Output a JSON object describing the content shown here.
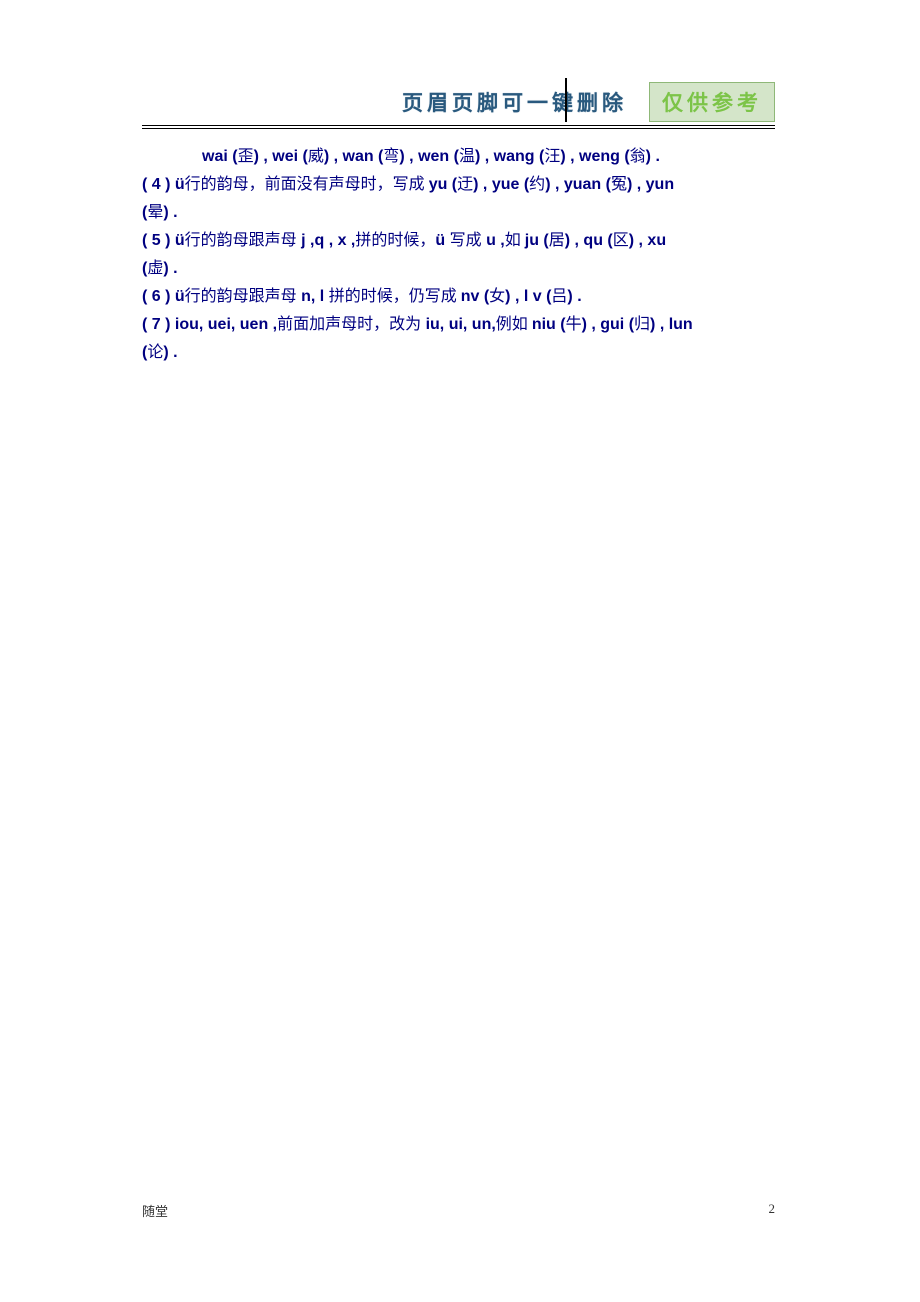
{
  "header": {
    "title": "页眉页脚可一键删除",
    "badge": "仅供参考"
  },
  "content": {
    "line1_prefix": "wai (",
    "line1_c1": "歪",
    "line1_m1": ") ,  wei  (",
    "line1_c2": "威",
    "line1_m2": ") , wan (",
    "line1_c3": "弯",
    "line1_m3": ") , wen (",
    "line1_c4": "温",
    "line1_m4": ") , wang (",
    "line1_c5": "汪",
    "line1_m5": ") , weng (",
    "line1_c6": "翁",
    "line1_end": ") .",
    "rule4_num": "( 4 )  ü",
    "rule4_cn1": "行的韵母，前面没有声母时，写成 ",
    "rule4_b1": "yu (",
    "rule4_c1": "迂",
    "rule4_b2": ") , yue (",
    "rule4_c2": "约",
    "rule4_b3": ") , yuan (",
    "rule4_c3": "冤",
    "rule4_b4": ") , yun",
    "rule4_b5": "(",
    "rule4_c4": "晕",
    "rule4_end": ") .",
    "rule5_num": "( 5 )  ü",
    "rule5_cn1": "行的韵母跟声母",
    "rule5_b1": " j ,q , x ,",
    "rule5_cn2": "拼的时候，",
    "rule5_b2": "ü ",
    "rule5_cn3": "写成",
    "rule5_b3": " u ,",
    "rule5_cn4": "如   ",
    "rule5_b4": "ju (",
    "rule5_c1": "居",
    "rule5_b5": ") , qu (",
    "rule5_c2": "区",
    "rule5_b6": ") , xu",
    "rule5_b7": "(",
    "rule5_c3": "虚",
    "rule5_end": ") .",
    "rule6_num": "( 6 )  ü",
    "rule6_cn1": "行的韵母跟声母",
    "rule6_b1": " n, l ",
    "rule6_cn2": "拼的时候，仍写成   ",
    "rule6_b2": "nv (",
    "rule6_c1": "女",
    "rule6_b3": ") , l v (",
    "rule6_c2": "吕",
    "rule6_end": ") .",
    "rule7_num": "( 7 )  iou, uei, uen ,",
    "rule7_cn1": "前面加声母时，改为",
    "rule7_b1": " iu, ui, un,",
    "rule7_cn2": "例如   ",
    "rule7_b2": "niu (",
    "rule7_c1": "牛",
    "rule7_b3": ") , gui (",
    "rule7_c2": "归",
    "rule7_b4": ") , lun",
    "rule7_b5": "(",
    "rule7_c3": "论",
    "rule7_end": ") ."
  },
  "footer": {
    "left": "随堂",
    "right": "2"
  }
}
